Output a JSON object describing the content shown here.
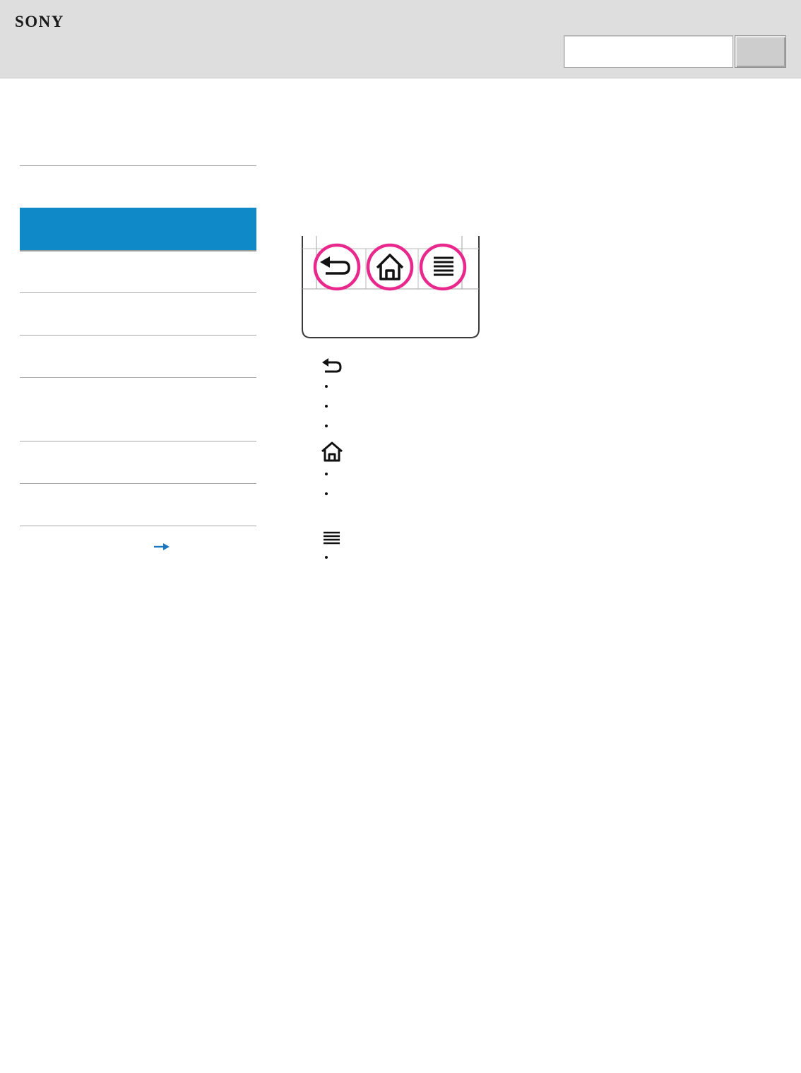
{
  "header": {
    "brand": "SONY",
    "search": {
      "value": "",
      "placeholder": ""
    },
    "search_button_label": ""
  },
  "sidebar": {
    "items": [
      {
        "label": "",
        "active": false
      },
      {
        "label": "",
        "active": true
      },
      {
        "label": "",
        "active": false
      },
      {
        "label": "",
        "active": false
      },
      {
        "label": "",
        "active": false
      },
      {
        "label": "",
        "active": false
      },
      {
        "label": "",
        "active": false
      },
      {
        "label": "",
        "active": false
      }
    ],
    "more_link": ""
  },
  "main": {
    "illustration": {
      "keys": [
        "back-icon",
        "home-icon",
        "menu-icon"
      ],
      "highlight_color": "#e8288c"
    },
    "sections": [
      {
        "icon": "back-icon",
        "bullets": [
          "",
          "",
          ""
        ]
      },
      {
        "icon": "home-icon",
        "bullets": [
          "",
          ""
        ]
      },
      {
        "icon": "menu-icon",
        "bullets": [
          ""
        ]
      }
    ]
  },
  "colors": {
    "header_bg": "#dedede",
    "active_nav": "#0f89c7",
    "link": "#1a78c2"
  }
}
